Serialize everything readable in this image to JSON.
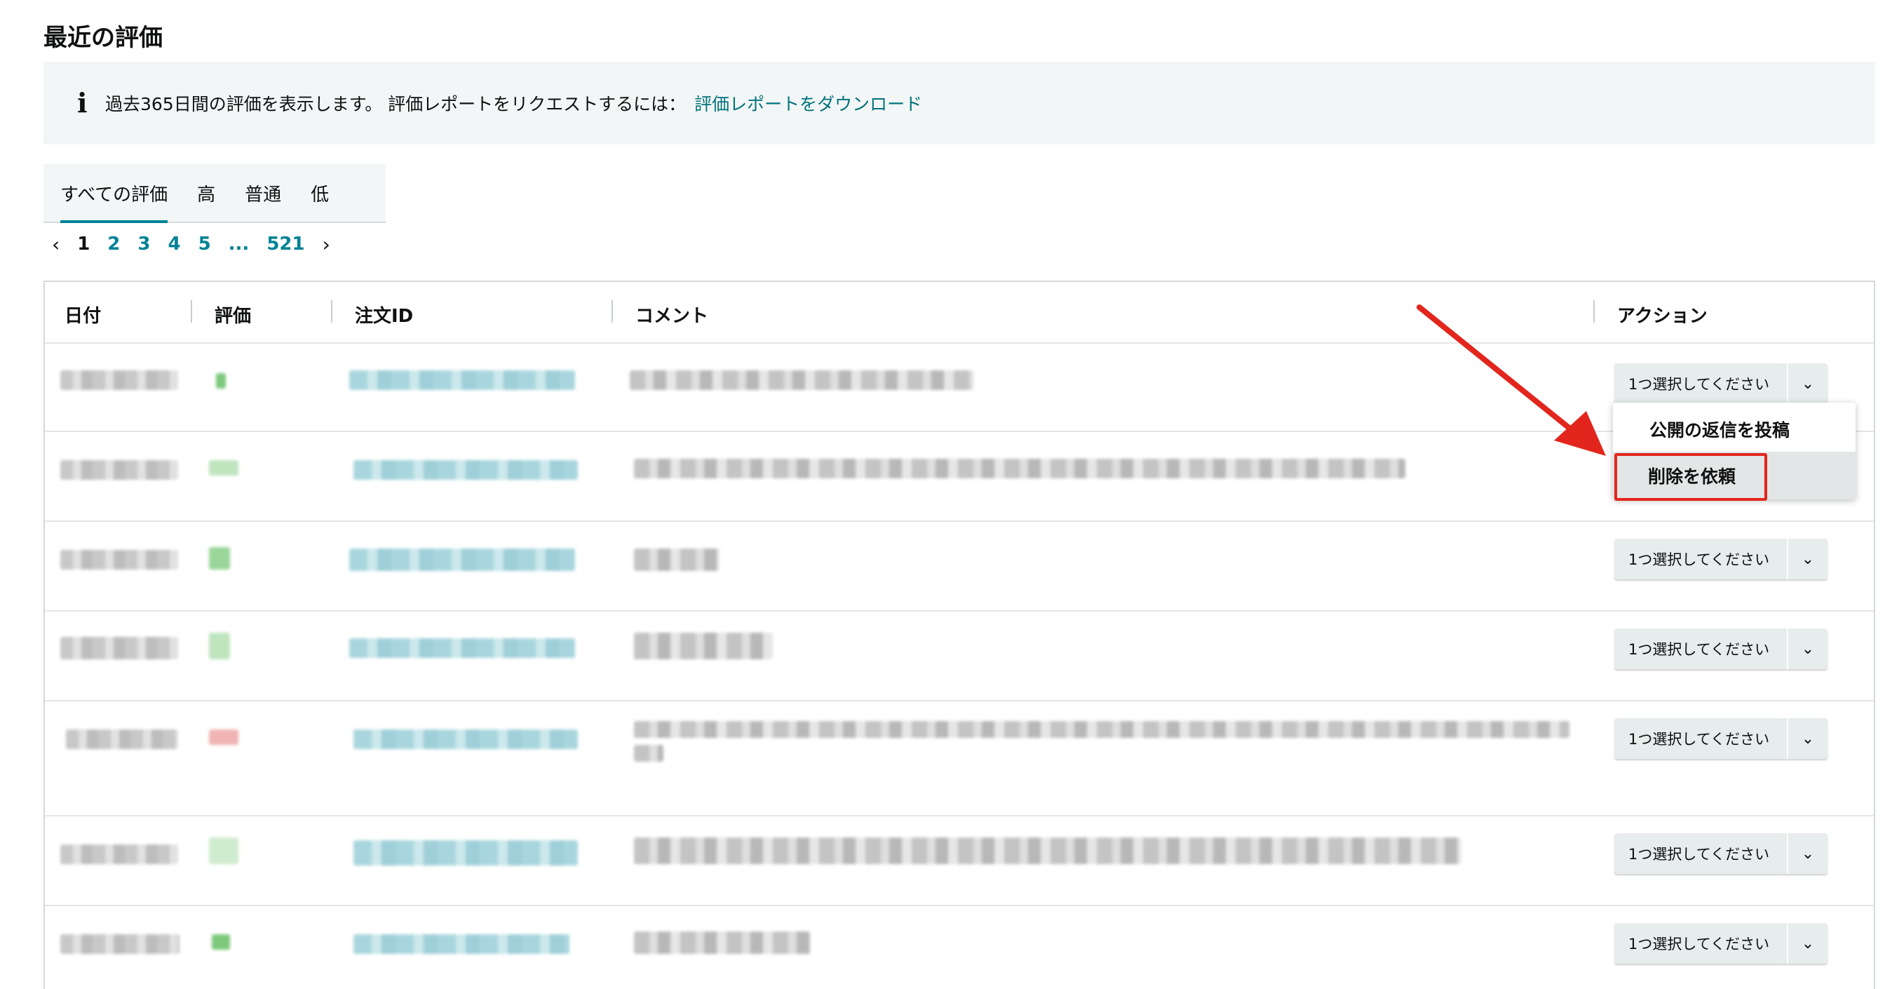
{
  "page": {
    "title": "最近の評価"
  },
  "info": {
    "text": "過去365日間の評価を表示します。 評価レポートをリクエストするには：",
    "link": "評価レポートをダウンロード"
  },
  "tabs": [
    {
      "label": "すべての評価",
      "active": true
    },
    {
      "label": "高",
      "active": false
    },
    {
      "label": "普通",
      "active": false
    },
    {
      "label": "低",
      "active": false
    }
  ],
  "pagination": {
    "prev": "‹",
    "pages": [
      "1",
      "2",
      "3",
      "4",
      "5"
    ],
    "ellipsis": "...",
    "last": "521",
    "next": "›",
    "current": "1"
  },
  "table": {
    "headers": [
      "日付",
      "評価",
      "注文ID",
      "コメント",
      "アクション"
    ],
    "action_label": "1つ選択してください",
    "rows": [
      {
        "rating": "high"
      },
      {
        "rating": "high"
      },
      {
        "rating": "high"
      },
      {
        "rating": "high"
      },
      {
        "rating": "low"
      },
      {
        "rating": "high"
      },
      {
        "rating": "high"
      }
    ]
  },
  "dropdown": {
    "items": [
      "公開の返信を投稿",
      "削除を依頼"
    ]
  },
  "colors": {
    "accent": "#008296",
    "link": "#00737b",
    "annotation_red": "#e3261d",
    "rating_high": "#7cc97c",
    "rating_low": "#f1b4b4"
  }
}
